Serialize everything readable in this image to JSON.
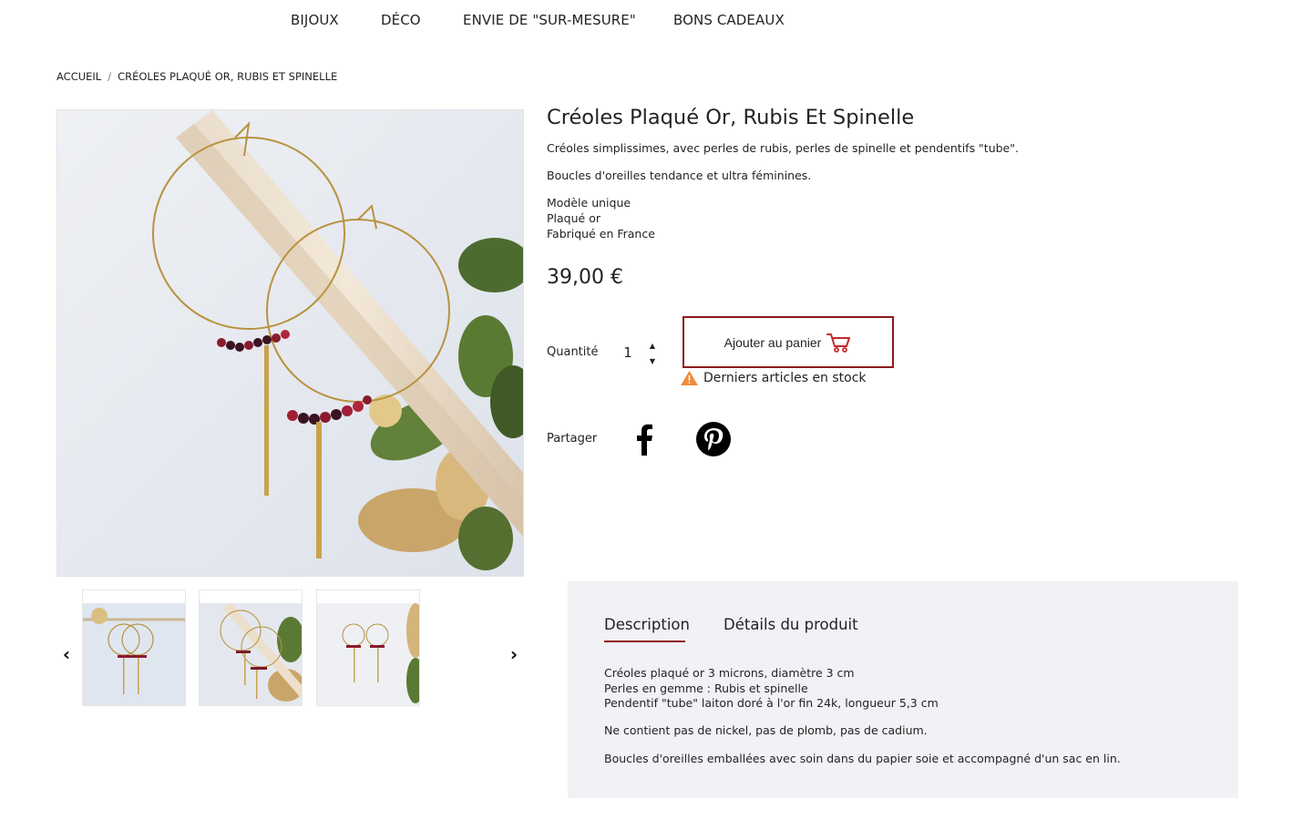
{
  "nav": {
    "items": [
      "BIJOUX",
      "DÉCO",
      "ENVIE DE \"SUR-MESURE\"",
      "BONS CADEAUX"
    ]
  },
  "breadcrumb": {
    "home": "ACCUEIL",
    "separator": "/",
    "current": "CRÉOLES PLAQUÉ OR, RUBIS ET SPINELLE"
  },
  "product": {
    "title": "Créoles Plaqué Or, Rubis Et Spinelle",
    "summary_1": "Créoles simplissimes, avec perles de rubis, perles de spinelle et pendentifs \"tube\".",
    "summary_2": "Boucles d'oreilles tendance et ultra féminines.",
    "features": [
      "Modèle unique",
      "Plaqué or",
      "Fabriqué en France"
    ],
    "price": "39,00 €",
    "quantity_label": "Quantité",
    "quantity_value": "1",
    "add_to_cart": "Ajouter au panier",
    "stock_notice": "Derniers articles en stock",
    "share_label": "Partager"
  },
  "gallery": {
    "thumbnails": [
      "thumbnail-1",
      "thumbnail-2",
      "thumbnail-3"
    ],
    "prev_icon": "chevron-left-icon",
    "next_icon": "chevron-right-icon"
  },
  "tabs": {
    "description": "Description",
    "details": "Détails du produit"
  },
  "description": {
    "lines": [
      "Créoles plaqué or 3 microns, diamètre 3 cm",
      "Perles en gemme : Rubis et spinelle",
      "Pendentif \"tube\" laiton doré à l'or fin 24k, longueur 5,3 cm"
    ],
    "para_2": "Ne contient pas de nickel, pas de plomb, pas de cadium.",
    "para_3": "Boucles d'oreilles emballées avec soin dans du papier soie et accompagné d'un sac en lin."
  },
  "colors": {
    "accent": "#8e1b1b",
    "cart_icon": "#c42a2a",
    "warning": "#f08c3c",
    "panel_bg": "#f1f2f6"
  }
}
